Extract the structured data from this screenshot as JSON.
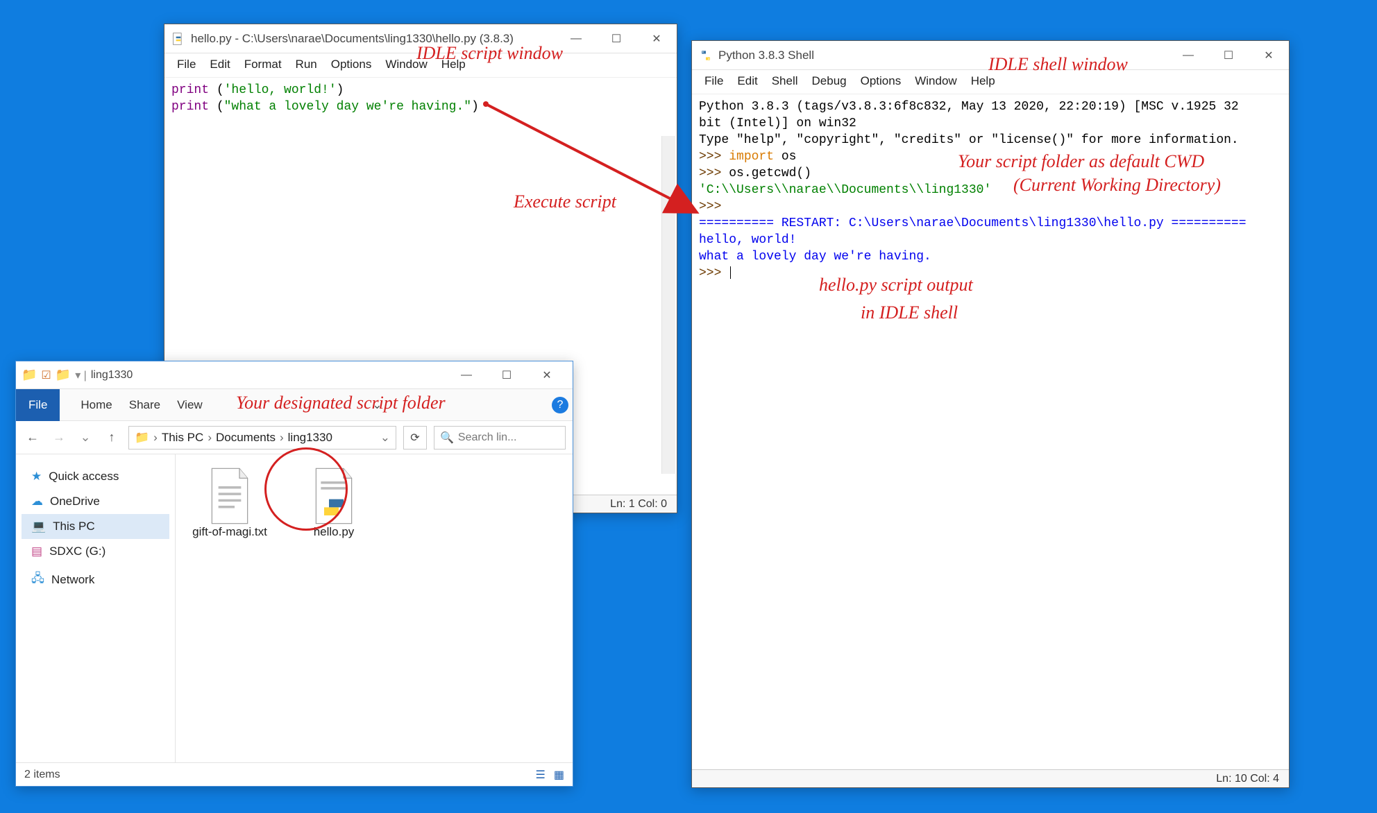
{
  "script_window": {
    "title": "hello.py - C:\\Users\\narae\\Documents\\ling1330\\hello.py (3.8.3)",
    "menu": [
      "File",
      "Edit",
      "Format",
      "Run",
      "Options",
      "Window",
      "Help"
    ],
    "line1_fn": "print",
    "line1_rest": " (",
    "line1_str": "'hello, world!'",
    "line1_end": ")",
    "line2_fn": "print",
    "line2_rest": " (",
    "line2_str": "\"what a lovely day we're having.\"",
    "line2_end": ")",
    "status": "Ln: 1  Col: 0"
  },
  "shell_window": {
    "title": "Python 3.8.3 Shell",
    "menu": [
      "File",
      "Edit",
      "Shell",
      "Debug",
      "Options",
      "Window",
      "Help"
    ],
    "banner1": "Python 3.8.3 (tags/v3.8.3:6f8c832, May 13 2020, 22:20:19) [MSC v.1925 32",
    "banner2": "bit (Intel)] on win32",
    "banner3": "Type \"help\", \"copyright\", \"credits\" or \"license()\" for more information.",
    "p1": ">>> ",
    "import_kw": "import",
    "import_rest": " os",
    "p2": ">>> ",
    "getcwd": "os.getcwd()",
    "cwd": "'C:\\\\Users\\\\narae\\\\Documents\\\\ling1330'",
    "p3": ">>> ",
    "restart": "========== RESTART: C:\\Users\\narae\\Documents\\ling1330\\hello.py ==========",
    "out1": "hello, world!",
    "out2": "what a lovely day we're having.",
    "p4": ">>> ",
    "status": "Ln: 10  Col: 4"
  },
  "explorer": {
    "tab_title": "ling1330",
    "ribbon_file": "File",
    "ribbon": [
      "Home",
      "Share",
      "View"
    ],
    "crumbs": [
      "This PC",
      "Documents",
      "ling1330"
    ],
    "search_placeholder": "Search lin...",
    "sidebar": [
      "Quick access",
      "OneDrive",
      "This PC",
      "SDXC (G:)",
      "Network"
    ],
    "files": [
      {
        "name": "gift-of-magi.txt",
        "type": "txt"
      },
      {
        "name": "hello.py",
        "type": "py"
      }
    ],
    "status": "2 items"
  },
  "annotations": {
    "script_label": "IDLE script window",
    "shell_label": "IDLE shell window",
    "exec_label": "Execute script",
    "cwd_label1": "Your script folder as default CWD",
    "cwd_label2": "(Current Working Directory)",
    "out_label1": "hello.py script output",
    "out_label2": "in IDLE shell",
    "folder_label": "Your designated script folder"
  }
}
